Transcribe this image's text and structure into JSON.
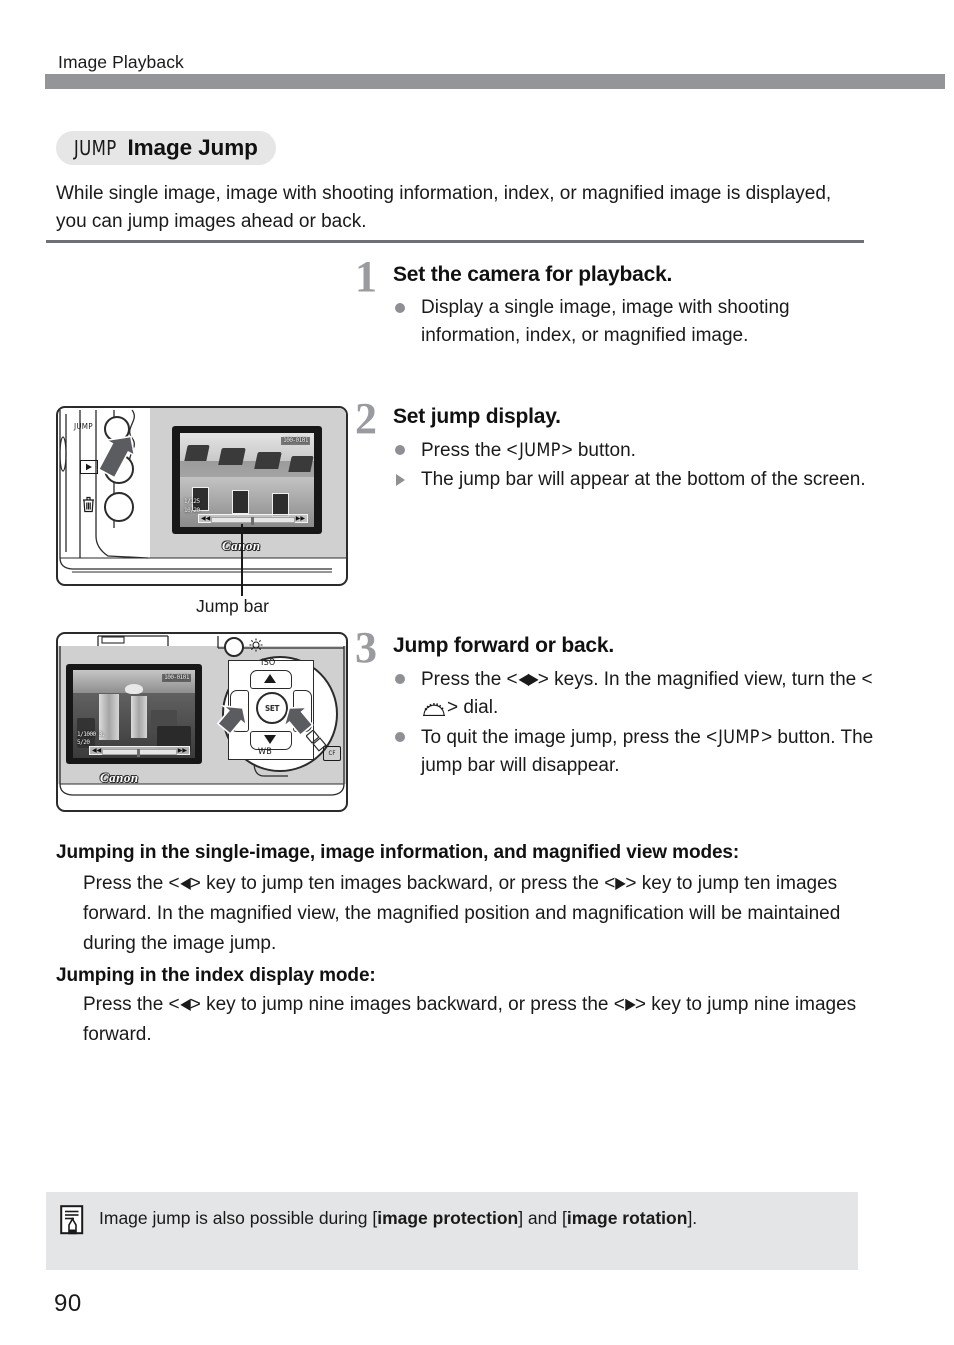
{
  "page": {
    "running_head": "Image Playback",
    "page_number": "90",
    "header_bar_color": "#949599",
    "accent_gray": "#8e9094"
  },
  "section": {
    "badge_icon_label": "JUMP",
    "title": "Image Jump",
    "intro": "While single image, image with shooting information, index, or magnified image is displayed, you can jump images ahead or back."
  },
  "steps": [
    {
      "number": "1",
      "heading": "Set the camera for playback.",
      "items": [
        {
          "marker": "dot",
          "text": "Display a single image, image with shooting information, index, or magnified image."
        }
      ]
    },
    {
      "number": "2",
      "heading": "Set jump display.",
      "items": [
        {
          "marker": "dot",
          "text_before": "Press the <",
          "key": "JUMP",
          "text_after": ">  button."
        },
        {
          "marker": "triangle",
          "text": "The jump bar will appear at the bottom of the screen."
        }
      ]
    },
    {
      "number": "3",
      "heading": "Jump forward or back.",
      "items": [
        {
          "marker": "dot",
          "text_before": "Press the <",
          "key": "◀▶",
          "text_mid": "> keys. In the magnified view, turn the <",
          "key2": "dial-icon",
          "text_after": "> dial."
        },
        {
          "marker": "dot",
          "text_before": "To quit the image jump, press the <",
          "key": "JUMP",
          "text_after": ">  button. The jump bar will disappear."
        }
      ]
    }
  ],
  "figure_caption": "Jump bar",
  "figures": {
    "figure1": {
      "name": "camera-back-jump-button",
      "button_labels": {
        "jump": "JUMP",
        "playback": "▶",
        "erase": "trash"
      },
      "lcd": {
        "folder_text": "100-0101",
        "exif_line1": "1/125",
        "exif_line2": "10/20",
        "jumpbar_left": "◀◀",
        "jumpbar_right": "▶▶"
      },
      "brand": "Canon"
    },
    "figure2": {
      "name": "camera-back-cross-keys",
      "pad_labels": {
        "top": "ISO",
        "bottom": "WB",
        "center": "SET",
        "card": "CF"
      },
      "lcd": {
        "folder_text": "100-0101",
        "exif_line1": "1/1000  3.",
        "exif_line2": "5/20",
        "jumpbar_left": "◀◀",
        "jumpbar_right": "▶▶"
      },
      "brand": "Canon"
    }
  },
  "lower_sections": [
    {
      "heading": "Jumping in the single-image, image information, and magnified view modes:",
      "body_parts": [
        "Press the <",
        "◀",
        "> key to jump ten images backward, or press the <",
        "▶",
        "> key to jump ten images forward. In the magnified view, the magnified position and magnification will be maintained during the image jump."
      ]
    },
    {
      "heading": "Jumping in the index display mode:",
      "body_parts": [
        "Press the <",
        "◀",
        "> key to jump nine images backward, or press the <",
        "▶",
        "> key to jump nine images forward."
      ]
    }
  ],
  "note": {
    "icon": "note-pencil-icon",
    "text_1": "Image jump is also possible during [",
    "bold_1": "image protection",
    "text_2": "] and [",
    "bold_2": "image rotation",
    "text_3": "]."
  }
}
